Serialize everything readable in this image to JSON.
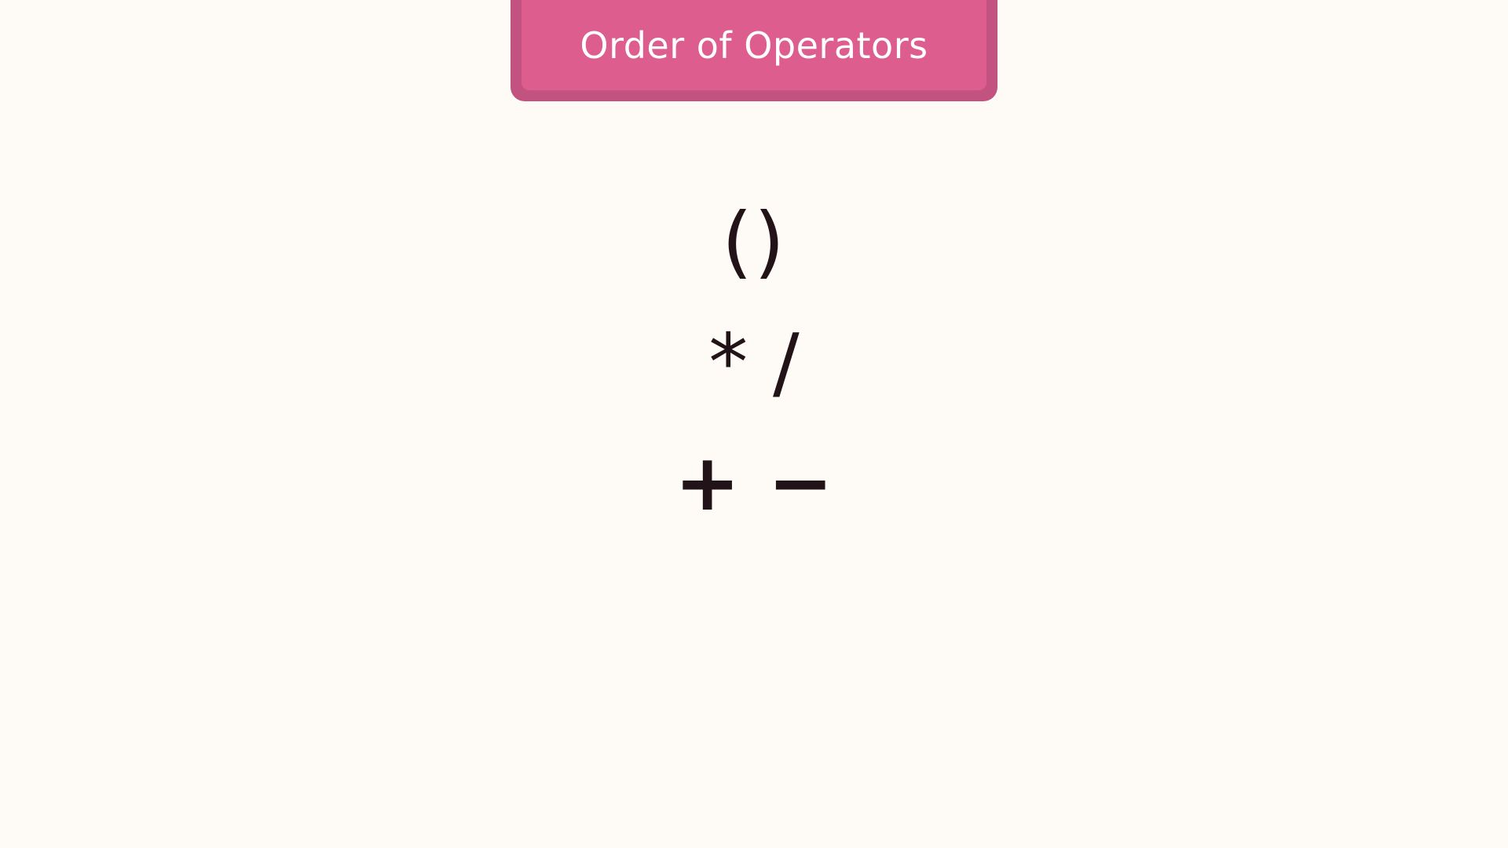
{
  "slide": {
    "title": "Order of Operators",
    "operator_rows": [
      {
        "symbols": "()"
      },
      {
        "symbols": "* /"
      },
      {
        "symbols": "+ −"
      }
    ]
  },
  "colors": {
    "background": "#fefbf6",
    "title_fill": "#dd5d8e",
    "title_border": "#c25380",
    "title_text": "#ffffff",
    "operator_text": "#221318"
  }
}
